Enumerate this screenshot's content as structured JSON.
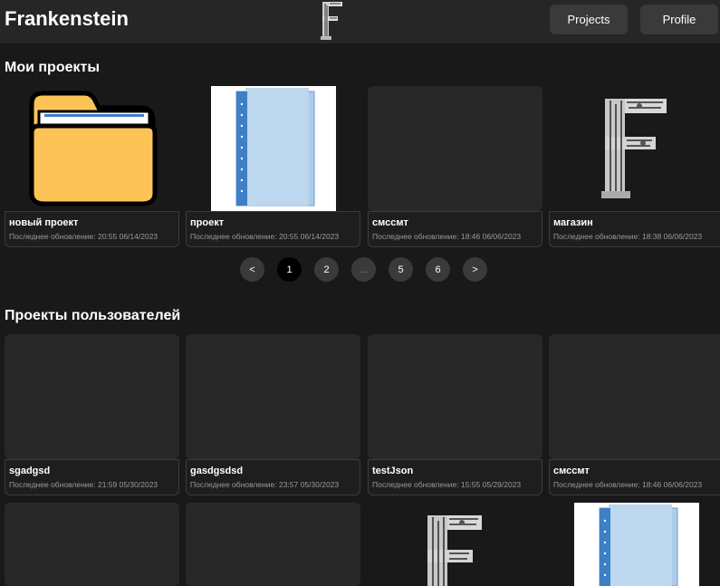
{
  "header": {
    "brand": "Frankenstein",
    "projects_label": "Projects",
    "profile_label": "Profile"
  },
  "my_projects": {
    "title": "Мои проекты",
    "cards": [
      {
        "name": "новый проект",
        "updated": "Последнее обновление: 20:55 06/14/2023",
        "thumb": "folder-icon"
      },
      {
        "name": "проект",
        "updated": "Последнее обновление: 20:55 06/14/2023",
        "thumb": "binder-image"
      },
      {
        "name": "смссмт",
        "updated": "Последнее обновление: 18:46 06/06/2023",
        "thumb": "empty"
      },
      {
        "name": "магазин",
        "updated": "Последнее обновление: 18:38 06/06/2023",
        "thumb": "f-logo"
      }
    ]
  },
  "pagination": {
    "prev": "<",
    "pages": [
      "1",
      "2",
      "...",
      "5",
      "6"
    ],
    "next": ">",
    "current": "1"
  },
  "user_projects": {
    "title": "Проекты пользователей",
    "cards": [
      {
        "name": "sgadgsd",
        "updated": "Последнее обновление: 21:59 05/30/2023"
      },
      {
        "name": "gasdgsdsd",
        "updated": "Последнее обновление: 23:57 05/30/2023"
      },
      {
        "name": "testJson",
        "updated": "Последнее обновление: 15:55 05/29/2023"
      },
      {
        "name": "смссмт",
        "updated": "Последнее обновление: 18:46 06/06/2023"
      }
    ]
  },
  "colors": {
    "background": "#191919",
    "header": "#262626",
    "card": "#282828",
    "button": "#3a3a3a",
    "active_page": "#000000",
    "folder": "#fcc457"
  }
}
